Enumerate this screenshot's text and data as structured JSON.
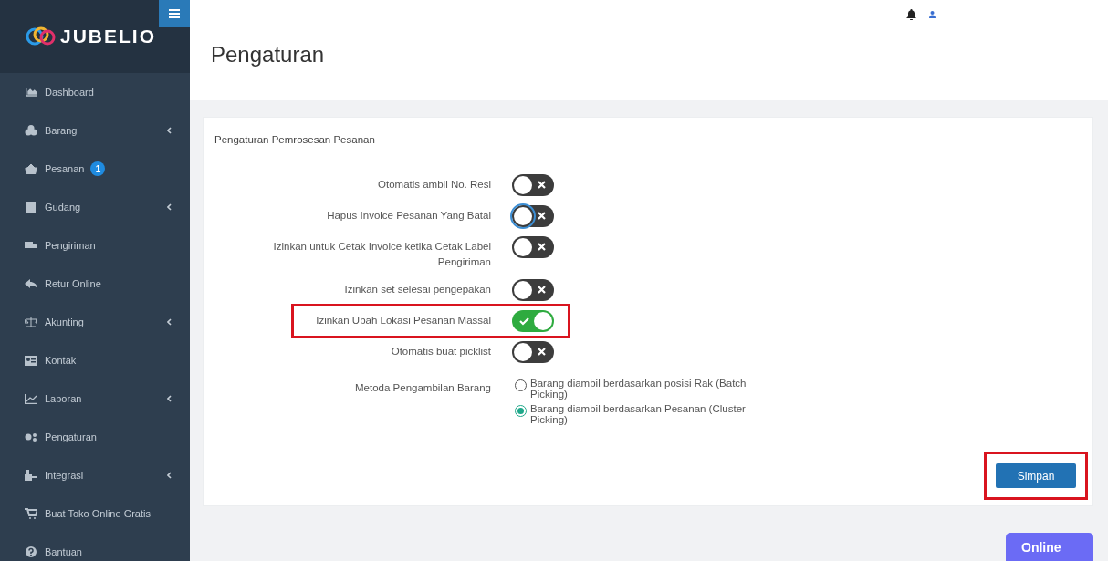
{
  "sidebar": {
    "logo": "JUBELIO",
    "items": [
      {
        "label": "Dashboard",
        "expandable": false
      },
      {
        "label": "Barang",
        "expandable": true
      },
      {
        "label": "Pesanan",
        "expandable": false,
        "badge": "1"
      },
      {
        "label": "Gudang",
        "expandable": true
      },
      {
        "label": "Pengiriman",
        "expandable": false
      },
      {
        "label": "Retur Online",
        "expandable": false
      },
      {
        "label": "Akunting",
        "expandable": true
      },
      {
        "label": "Kontak",
        "expandable": false
      },
      {
        "label": "Laporan",
        "expandable": true
      },
      {
        "label": "Pengaturan",
        "expandable": false
      },
      {
        "label": "Integrasi",
        "expandable": true
      },
      {
        "label": "Buat Toko Online Gratis",
        "expandable": false
      },
      {
        "label": "Bantuan",
        "expandable": false
      }
    ]
  },
  "header": {
    "title": "Pengaturan"
  },
  "card": {
    "title": "Pengaturan Pemrosesan Pesanan",
    "settings": [
      {
        "kind": "toggle",
        "label": "Otomatis ambil No. Resi",
        "on": false,
        "focused": false,
        "highlighted": false
      },
      {
        "kind": "toggle",
        "label": "Hapus Invoice Pesanan Yang Batal",
        "on": false,
        "focused": true,
        "highlighted": false
      },
      {
        "kind": "toggle",
        "label": "Izinkan untuk Cetak Invoice ketika Cetak Label Pengiriman",
        "on": false,
        "focused": false,
        "highlighted": false
      },
      {
        "kind": "toggle",
        "label": "Izinkan set selesai pengepakan",
        "on": false,
        "focused": false,
        "highlighted": false
      },
      {
        "kind": "toggle",
        "label": "Izinkan Ubah Lokasi Pesanan Massal",
        "on": true,
        "focused": false,
        "highlighted": true
      },
      {
        "kind": "toggle",
        "label": "Otomatis buat picklist",
        "on": false,
        "focused": false,
        "highlighted": false
      },
      {
        "kind": "radio",
        "label": "Metoda Pengambilan Barang",
        "options": [
          {
            "label": "Barang diambil berdasarkan posisi Rak (Batch Picking)",
            "selected": false
          },
          {
            "label": "Barang diambil berdasarkan Pesanan (Cluster Picking)",
            "selected": true
          }
        ]
      }
    ],
    "save_button": {
      "label": "Simpan",
      "highlighted": true
    }
  },
  "online_button": {
    "label": "Online"
  }
}
